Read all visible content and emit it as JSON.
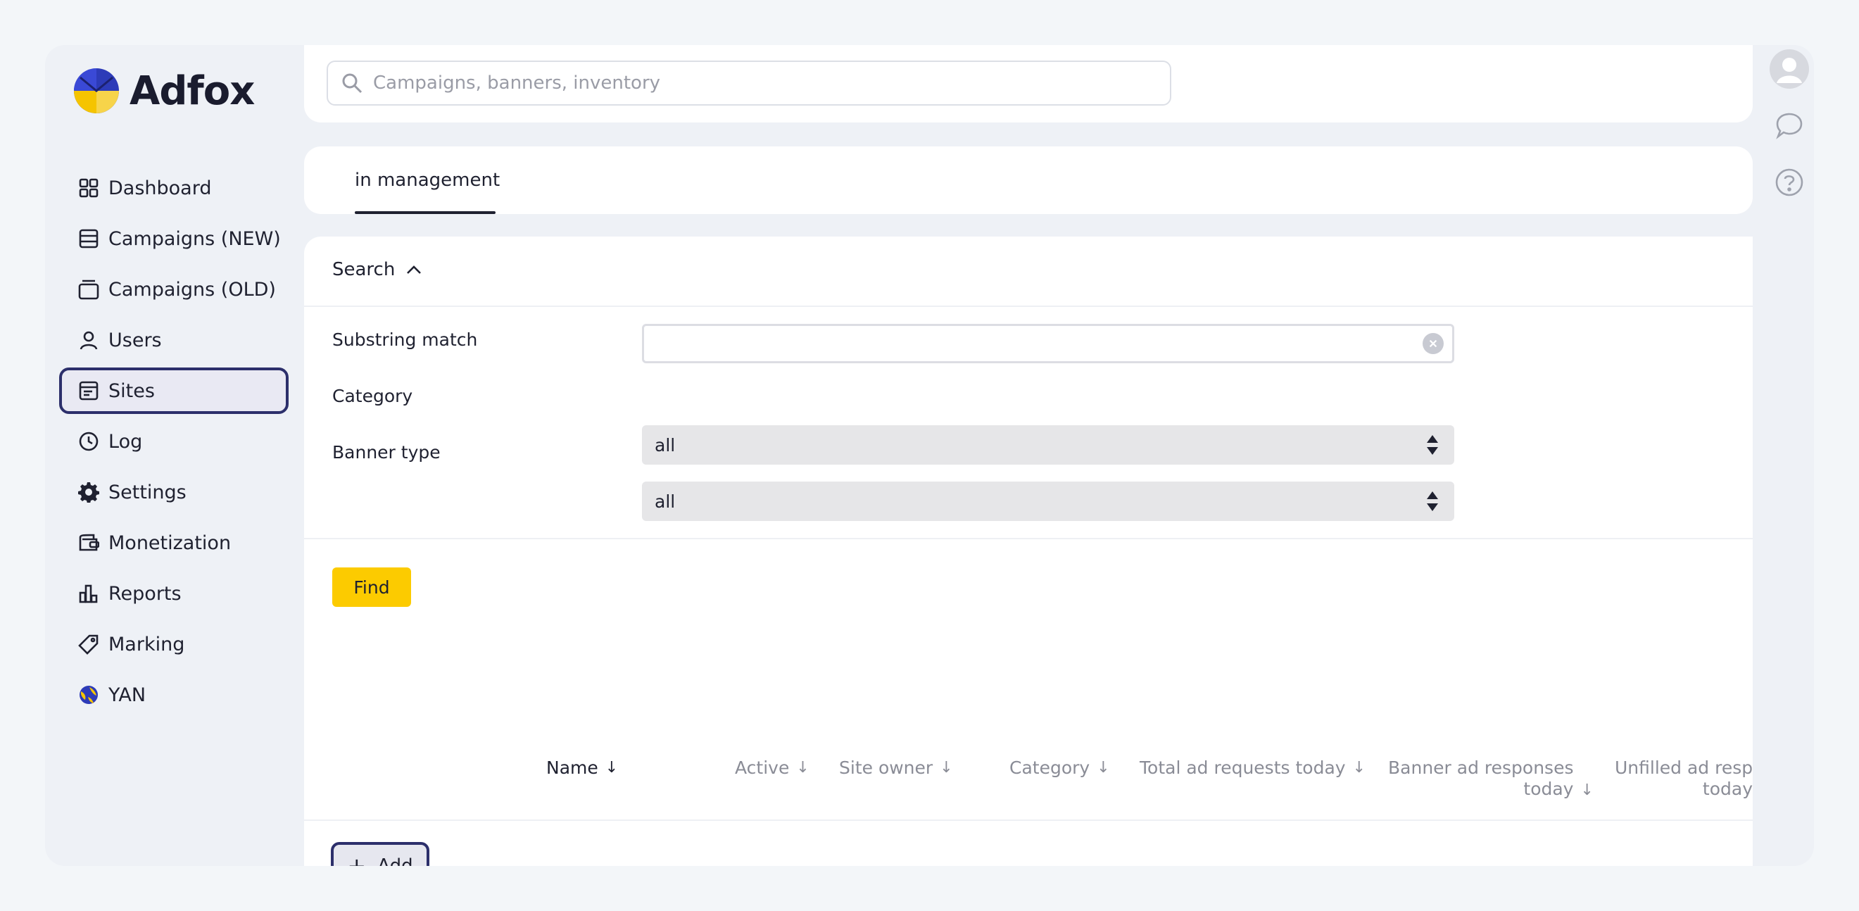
{
  "app": {
    "name": "Adfox",
    "accent": "#fccb00",
    "focus_color": "#2c2f6b"
  },
  "search": {
    "placeholder": "Campaigns, banners, inventory",
    "value": ""
  },
  "sidebar": {
    "items": [
      {
        "label": "Dashboard",
        "icon": "grid-icon"
      },
      {
        "label": "Campaigns (NEW)",
        "icon": "list-icon"
      },
      {
        "label": "Campaigns (OLD)",
        "icon": "stack-icon"
      },
      {
        "label": "Users",
        "icon": "user-icon"
      },
      {
        "label": "Sites",
        "icon": "browser-icon",
        "active": true
      },
      {
        "label": "Log",
        "icon": "clock-icon"
      },
      {
        "label": "Settings",
        "icon": "gear-icon"
      },
      {
        "label": "Monetization",
        "icon": "wallet-icon"
      },
      {
        "label": "Reports",
        "icon": "bar-chart-icon"
      },
      {
        "label": "Marking",
        "icon": "tag-icon"
      },
      {
        "label": "YAN",
        "icon": "yan-globe-icon"
      }
    ]
  },
  "tabs": [
    {
      "label": "in management",
      "active": true
    }
  ],
  "filters": {
    "toggle_label": "Search",
    "substring": {
      "label": "Substring match",
      "value": ""
    },
    "category": {
      "label": "Category",
      "value": "all"
    },
    "banner_type": {
      "label": "Banner type",
      "value": "all"
    },
    "find_label": "Find"
  },
  "table": {
    "columns": [
      {
        "label": "Name",
        "sort": "↓"
      },
      {
        "label": "Active",
        "sort": "↓"
      },
      {
        "label": "Site owner",
        "sort": "↓"
      },
      {
        "label": "Category",
        "sort": "↓"
      },
      {
        "label": "Total ad requests today",
        "sort": "↓"
      },
      {
        "label_line1": "Banner ad responses",
        "label_line2": "today",
        "sort": "↓"
      },
      {
        "label_line1": "Unfilled ad responses",
        "label_line2": "today"
      }
    ]
  },
  "actions": {
    "add_label": "Add"
  }
}
